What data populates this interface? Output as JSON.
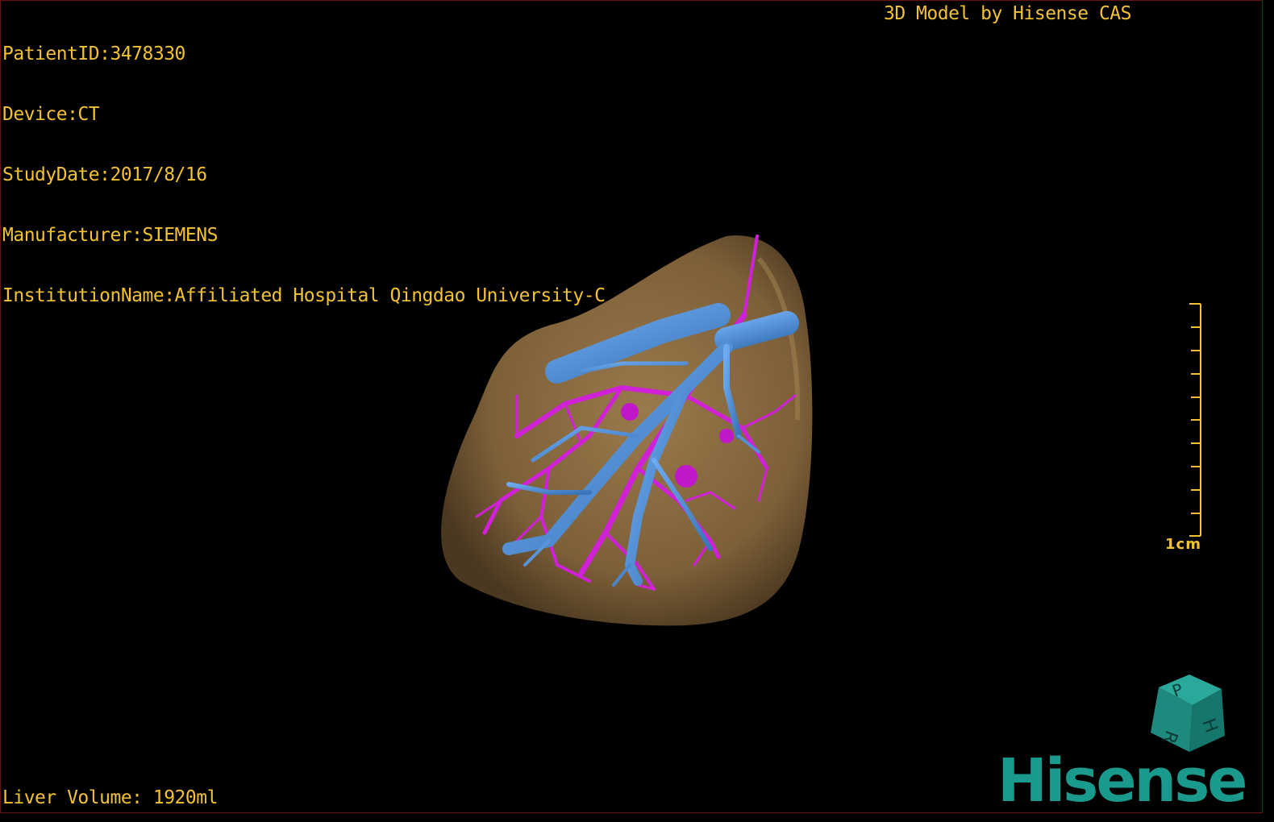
{
  "viewer": {
    "patient_id": "PatientID:3478330",
    "device": "Device:CT",
    "study_date": "StudyDate:2017/8/16",
    "manufacturer": "Manufacturer:SIEMENS",
    "institution": "InstitutionName:Affiliated Hospital Qingdao University-C",
    "model_credit": "3D Model by Hisense CAS",
    "liver_volume": "Liver Volume: 1920ml",
    "scale_label": "1cm",
    "logo_text": "Hisense",
    "orientation_cube": {
      "letters": [
        "P",
        "H",
        "R"
      ]
    }
  },
  "colors": {
    "overlay_text": "#f2c233",
    "liver": "#8a6a40",
    "portal_vein": "#4a8fd4",
    "hepatic_artery": "#d020d8",
    "logo": "#1a9a8c",
    "frame_border": "#6b1010"
  }
}
